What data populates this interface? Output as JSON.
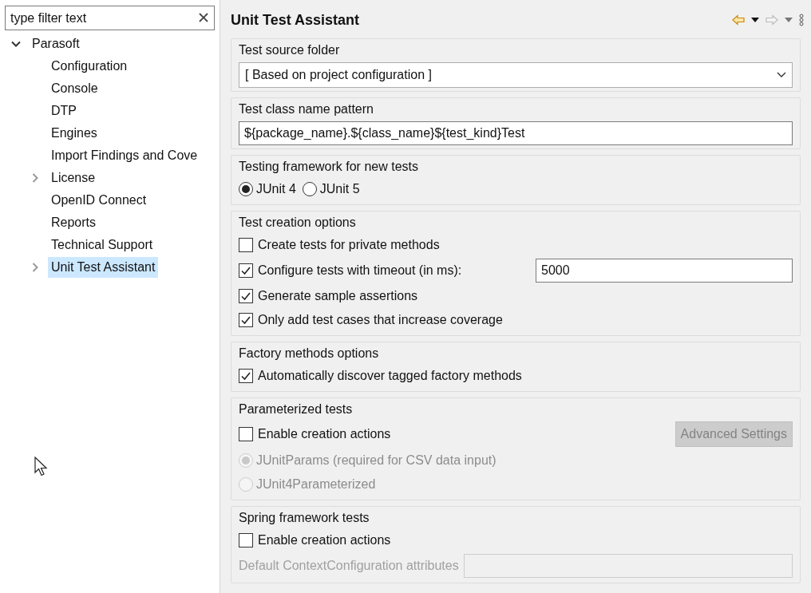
{
  "filter": {
    "placeholder": "type filter text"
  },
  "tree": [
    {
      "label": "Parasoft",
      "expanded": true,
      "selected": false,
      "children": [
        {
          "label": "Configuration",
          "selected": false
        },
        {
          "label": "Console",
          "selected": false
        },
        {
          "label": "DTP",
          "selected": false
        },
        {
          "label": "Engines",
          "selected": false
        },
        {
          "label": "Import Findings and Cove",
          "selected": false
        },
        {
          "label": "License",
          "expanded": false,
          "selected": false
        },
        {
          "label": "OpenID Connect",
          "selected": false
        },
        {
          "label": "Reports",
          "selected": false
        },
        {
          "label": "Technical Support",
          "selected": false
        },
        {
          "label": "Unit Test Assistant",
          "expanded": false,
          "selected": true
        }
      ]
    }
  ],
  "page": {
    "title": "Unit Test Assistant"
  },
  "groups": [
    {
      "title": "Test source folder",
      "rows": [
        {
          "kind": "select",
          "value": "[ Based on project configuration ]"
        }
      ]
    },
    {
      "title": "Test class name pattern",
      "rows": [
        {
          "kind": "text",
          "value": "${package_name}.${class_name}${test_kind}Test"
        }
      ]
    },
    {
      "title": "Testing framework for new tests",
      "rows": [
        {
          "kind": "radios",
          "options": [
            {
              "label": "JUnit 4",
              "selected": true
            },
            {
              "label": "JUnit 5",
              "selected": false
            }
          ]
        }
      ]
    },
    {
      "title": "Test creation options",
      "rows": [
        {
          "kind": "checkbox",
          "label": "Create tests for private methods",
          "checked": false
        },
        {
          "kind": "checkbox-field",
          "label": "Configure tests with timeout (in ms):",
          "checked": true,
          "value": "5000"
        },
        {
          "kind": "checkbox",
          "label": "Generate sample assertions",
          "checked": true
        },
        {
          "kind": "checkbox",
          "label": "Only add test cases that increase coverage",
          "checked": true
        }
      ]
    },
    {
      "title": "Factory methods options",
      "rows": [
        {
          "kind": "checkbox",
          "label": "Automatically discover tagged factory methods",
          "checked": true
        }
      ]
    },
    {
      "title": "Parameterized tests",
      "rows": [
        {
          "kind": "checkbox-button",
          "label": "Enable creation actions",
          "checked": false,
          "button": {
            "label": "Advanced Settings",
            "disabled": true
          }
        },
        {
          "kind": "radio",
          "label": "JUnitParams (required for CSV data input)",
          "selected": true,
          "disabled": true
        },
        {
          "kind": "radio",
          "label": "JUnit4Parameterized",
          "selected": false,
          "disabled": true
        }
      ]
    },
    {
      "title": "Spring framework tests",
      "rows": [
        {
          "kind": "checkbox",
          "label": "Enable creation actions",
          "checked": false
        },
        {
          "kind": "labeled-field",
          "label": "Default ContextConfiguration attributes",
          "disabled": true
        }
      ]
    }
  ]
}
